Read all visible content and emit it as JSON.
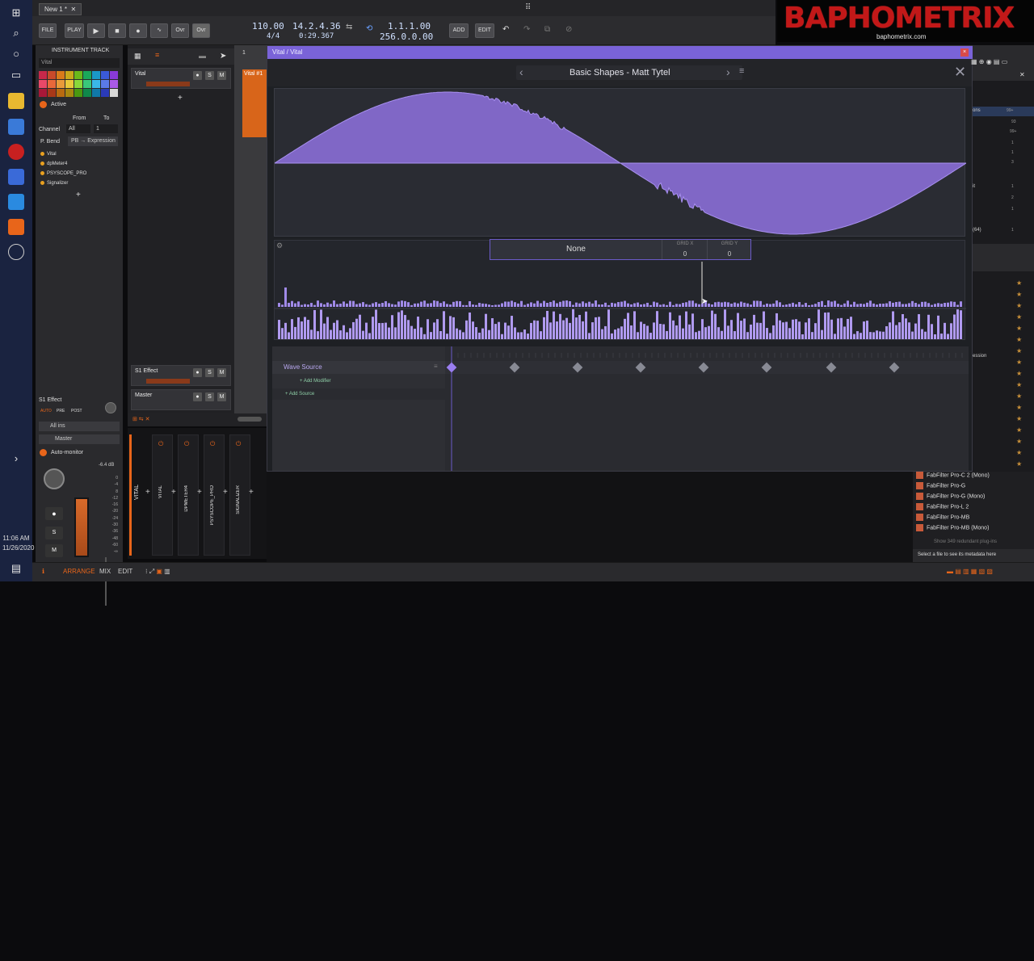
{
  "taskbar": {
    "clock_time": "11:06 AM",
    "clock_date": "11/26/2020"
  },
  "daw": {
    "tab_title": "New 1 *",
    "buttons": {
      "file": "FILE",
      "play": "PLAY",
      "ovr": "Ovr",
      "ovr2": "Ovr",
      "add": "ADD",
      "edit": "EDIT"
    },
    "tempo": "110.00",
    "time_signature": "4/4",
    "position_bars": "14.2.4.36",
    "position_time": "0:29.367",
    "loop_start": "1.1.1.00",
    "loop_end": "256.0.0.00"
  },
  "inspector": {
    "header": "INSTRUMENT TRACK",
    "track_name": "Vital",
    "active_label": "Active",
    "from_label": "From",
    "to_label": "To",
    "channel_label": "Channel",
    "channel_from": "All",
    "channel_to": "1",
    "pbend_label": "P. Bend",
    "pbend_value": "PB → Expression",
    "devices": [
      "Vital",
      "dpMeter4",
      "PSYSCOPE_PRO",
      "Signalizer"
    ],
    "s1_effect": "S1 Effect",
    "auto_label": "AUTO",
    "pre_label": "PRE",
    "post_label": "POST",
    "input": "All ins",
    "output": "Master",
    "automonitor": "Auto-monitor",
    "level": "-6.4 dB",
    "meter_scale": [
      "0",
      "-4",
      "8",
      "-12",
      "-16",
      "-20",
      "-24",
      "-30",
      "-36",
      "-48",
      "-60",
      "-∞"
    ],
    "s_label": "S",
    "m_label": "M"
  },
  "tracks": {
    "items": [
      "Vital",
      "S1 Effect",
      "Master"
    ],
    "clip_label": "Vital #1",
    "ruler": "1"
  },
  "mixer": {
    "strips": [
      "VITAL",
      "VITAL",
      "DPMETER4",
      "PSYSCOPE_PRO",
      "SIGNALIZER"
    ]
  },
  "vital": {
    "window_title": "Vital / Vital",
    "preset_name": "Basic Shapes",
    "preset_sep": "-",
    "preset_author": "Matt Tytel",
    "overlay_value": "None",
    "grid_x_label": "GRID X",
    "grid_x": "0",
    "grid_y_label": "GRID Y",
    "grid_y": "0",
    "wave_source": "Wave Source",
    "add_modifier": "Add Modifier",
    "add_source": "Add Source"
  },
  "browser": {
    "fragments": [
      "ons",
      "99+",
      "93",
      "99+",
      "1",
      "1",
      "3",
      "it",
      "1",
      "2",
      "1",
      "(64)",
      "1",
      "ession"
    ],
    "plugins": [
      "FabFilter Pro-C 2 (Mono)",
      "FabFilter Pro-G",
      "FabFilter Pro-G (Mono)",
      "FabFilter Pro-L 2",
      "FabFilter Pro-MB",
      "FabFilter Pro-MB (Mono)"
    ],
    "redundant": "Show 349 redundant plug-ins",
    "hint": "Select a file to see its metadata here"
  },
  "bottombar": {
    "arrange": "ARRANGE",
    "mix": "MIX",
    "edit": "EDIT"
  },
  "watermark": {
    "logo": "BAPHOMETRIX",
    "url": "baphometrix.com"
  },
  "colors": {
    "accent": "#7a63d8",
    "wave": "#8f72e0",
    "daw_orange": "#e8651a"
  }
}
